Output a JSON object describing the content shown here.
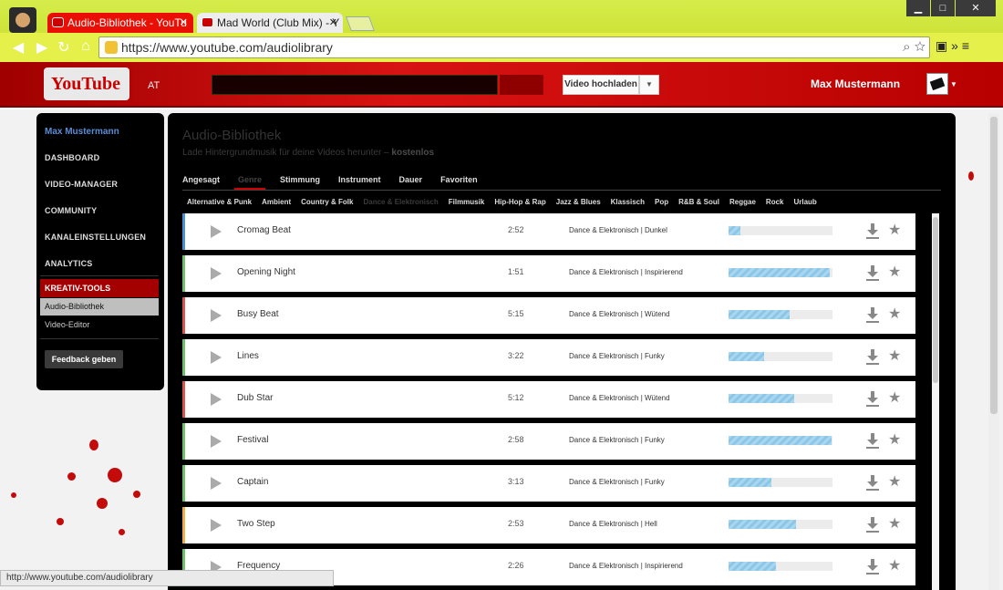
{
  "browser": {
    "tabs": [
      {
        "label": "Audio-Bibliothek - YouTu"
      },
      {
        "label": "Mad World (Club Mix) - Y"
      }
    ],
    "url": "https://www.youtube.com/audiolibrary",
    "status_url": "http://www.youtube.com/audiolibrary"
  },
  "header": {
    "logo": "YouTube",
    "country": "AT",
    "upload_label": "Video hochladen",
    "username": "Max Mustermann"
  },
  "leftnav": {
    "user": "Max Mustermann",
    "items": [
      "DASHBOARD",
      "VIDEO-MANAGER",
      "COMMUNITY",
      "KANALEINSTELLUNGEN",
      "ANALYTICS"
    ],
    "section": "KREATIV-TOOLS",
    "subitems": [
      "Audio-Bibliothek",
      "Video-Editor"
    ],
    "feedback": "Feedback geben"
  },
  "main": {
    "title": "Audio-Bibliothek",
    "subtitle": "Lade Hintergrundmusik für deine Videos herunter –",
    "subtitle_bold": "kostenlos",
    "tabs": [
      "Angesagt",
      "Genre",
      "Stimmung",
      "Instrument",
      "Dauer",
      "Favoriten"
    ],
    "genres": [
      "Alternative & Punk",
      "Ambient",
      "Country & Folk",
      "Dance & Elektronisch",
      "Filmmusik",
      "Hip-Hop & Rap",
      "Jazz & Blues",
      "Klassisch",
      "Pop",
      "R&B & Soul",
      "Reggae",
      "Rock",
      "Urlaub"
    ],
    "tracks": [
      {
        "name": "Cromag Beat",
        "duration": "2:52",
        "genre": "Dance & Elektronisch | Dunkel",
        "popularity": 0.11,
        "accent": "#4a90d9"
      },
      {
        "name": "Opening Night",
        "duration": "1:51",
        "genre": "Dance & Elektronisch | Inspirierend",
        "popularity": 0.97,
        "accent": "#6cbf6c"
      },
      {
        "name": "Busy Beat",
        "duration": "5:15",
        "genre": "Dance & Elektronisch | Wütend",
        "popularity": 0.59,
        "accent": "#d9534f"
      },
      {
        "name": "Lines",
        "duration": "3:22",
        "genre": "Dance & Elektronisch | Funky",
        "popularity": 0.34,
        "accent": "#6cbf6c"
      },
      {
        "name": "Dub Star",
        "duration": "5:12",
        "genre": "Dance & Elektronisch | Wütend",
        "popularity": 0.63,
        "accent": "#d9534f"
      },
      {
        "name": "Festival",
        "duration": "2:58",
        "genre": "Dance & Elektronisch | Funky",
        "popularity": 0.99,
        "accent": "#6cbf6c"
      },
      {
        "name": "Captain",
        "duration": "3:13",
        "genre": "Dance & Elektronisch | Funky",
        "popularity": 0.41,
        "accent": "#6cbf6c"
      },
      {
        "name": "Two Step",
        "duration": "2:53",
        "genre": "Dance & Elektronisch | Hell",
        "popularity": 0.65,
        "accent": "#f0ad4e"
      },
      {
        "name": "Frequency",
        "duration": "2:26",
        "genre": "Dance & Elektronisch | Inspirierend",
        "popularity": 0.46,
        "accent": "#6cbf6c"
      }
    ]
  }
}
